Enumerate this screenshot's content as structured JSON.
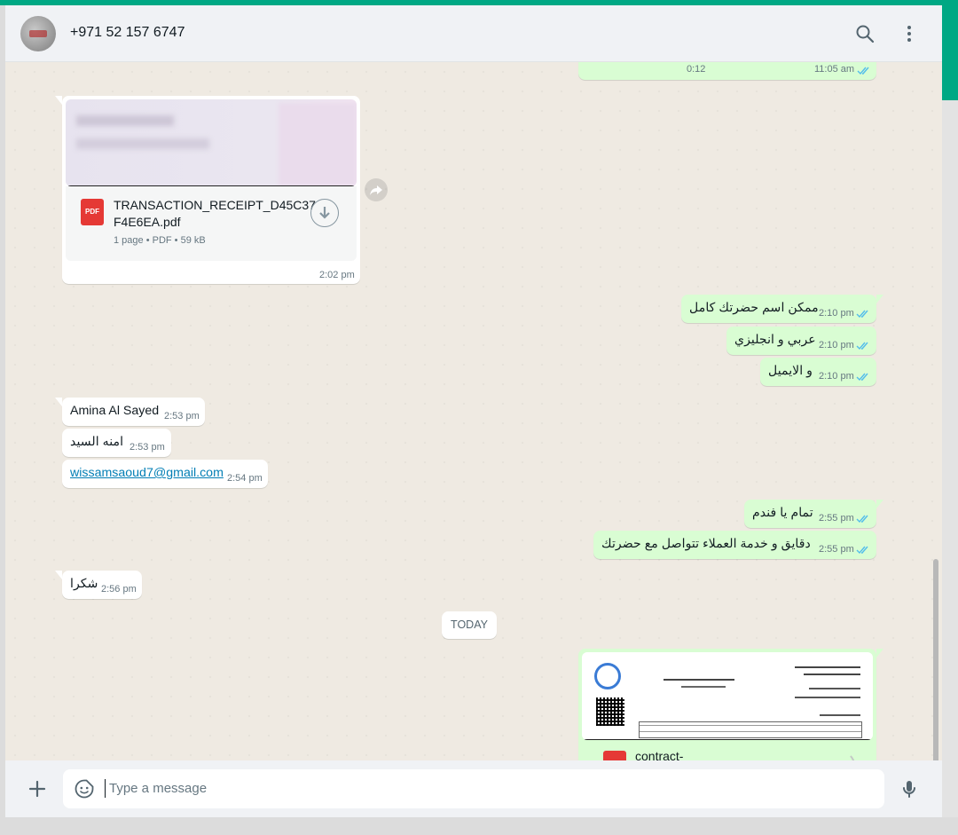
{
  "header": {
    "contact_name": "+971 52 157 6747",
    "search_icon": "search-icon",
    "menu_icon": "kebab-menu-icon"
  },
  "messages": {
    "voice": {
      "duration": "0:12",
      "time": "11:05 am",
      "status": "read"
    },
    "doc1": {
      "file_name_line1": "TRANSACTION_RECEIPT_D45C37",
      "file_name_line2": "F4E6EA.pdf",
      "meta": "1 page • PDF • 59 kB",
      "badge": "PDF",
      "time": "2:02 pm"
    },
    "out1": {
      "text": "ممكن اسم حضرتك كامل",
      "time": "2:10 pm"
    },
    "out2": {
      "text": "عربي و انجليزي",
      "time": "2:10 pm"
    },
    "out3": {
      "text": "و الايميل",
      "time": "2:10 pm"
    },
    "in1": {
      "text": "Amina Al Sayed",
      "time": "2:53 pm"
    },
    "in2": {
      "text": "امنه السيد",
      "time": "2:53 pm"
    },
    "in3": {
      "text": "wissamsaoud7@gmail.com",
      "time": "2:54 pm"
    },
    "out4": {
      "text": "تمام يا فندم",
      "time": "2:55 pm"
    },
    "out5": {
      "text": "دقايق و خدمة العملاء تتواصل مع حضرتك",
      "time": "2:55 pm"
    },
    "in4": {
      "text": "شكرا",
      "time": "2:56 pm"
    },
    "date_divider": "TODAY",
    "doc2": {
      "file_name": "contract-",
      "badge": "PDF"
    }
  },
  "composer": {
    "placeholder": "Type a message",
    "attach_icon": "plus-icon",
    "emoji_icon": "sticker-emoji-icon",
    "mic_icon": "microphone-icon"
  },
  "colors": {
    "accent": "#00a884",
    "outgoing_bubble": "#d9fdd3",
    "incoming_bubble": "#ffffff",
    "read_ticks": "#53bdeb",
    "link": "#027eb5"
  }
}
